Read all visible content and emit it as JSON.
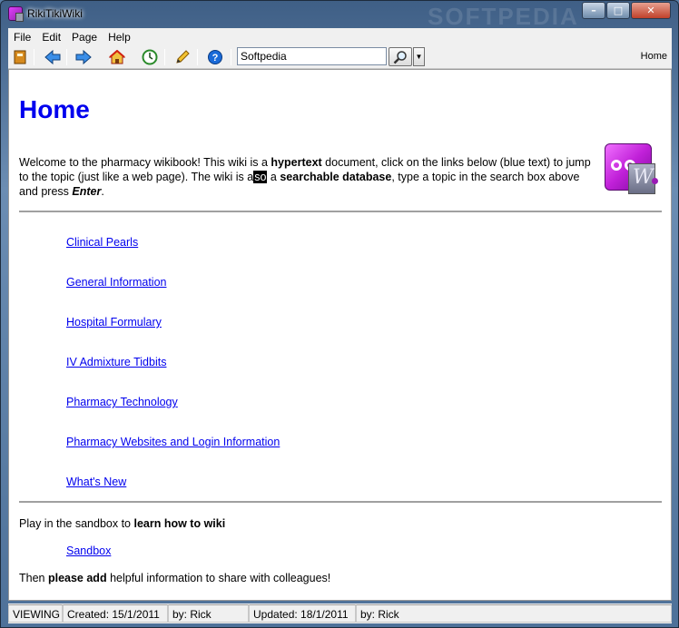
{
  "window": {
    "title": "RikiTikiWiki",
    "watermark": "SOFTPEDIA"
  },
  "menu": {
    "items": [
      "File",
      "Edit",
      "Page",
      "Help"
    ]
  },
  "toolbar": {
    "search": {
      "value": "Softpedia"
    },
    "current_page": "Home"
  },
  "content": {
    "heading": "Home",
    "intro": {
      "t1": "Welcome to the pharmacy wikibook! This wiki is a ",
      "b1": "hypertext",
      "t2": " document, click on the links below (blue text) to jump to the topic (just like a web page). The wiki is a",
      "hl": "so",
      "t3": " a ",
      "b2": "searchable database",
      "t4": ", type a topic in the search box above and press ",
      "bi": "Enter",
      "t5": "."
    },
    "links": [
      "Clinical Pearls",
      "General Information",
      "Hospital Formulary",
      "IV Admixture Tidbits",
      "Pharmacy Technology",
      "Pharmacy Websites and Login Information",
      "What's New"
    ],
    "sandbox_prompt": {
      "t1": "Play in the sandbox to ",
      "b1": "learn how to wiki"
    },
    "sandbox_link": "Sandbox",
    "closing": {
      "t1": "Then ",
      "b1": "please add",
      "t2": " helpful information to share with colleagues!"
    }
  },
  "status": {
    "mode": "VIEWING",
    "created": "Created: 15/1/2011",
    "created_by": "by: Rick",
    "updated": "Updated: 18/1/2011",
    "updated_by": "by: Rick"
  }
}
